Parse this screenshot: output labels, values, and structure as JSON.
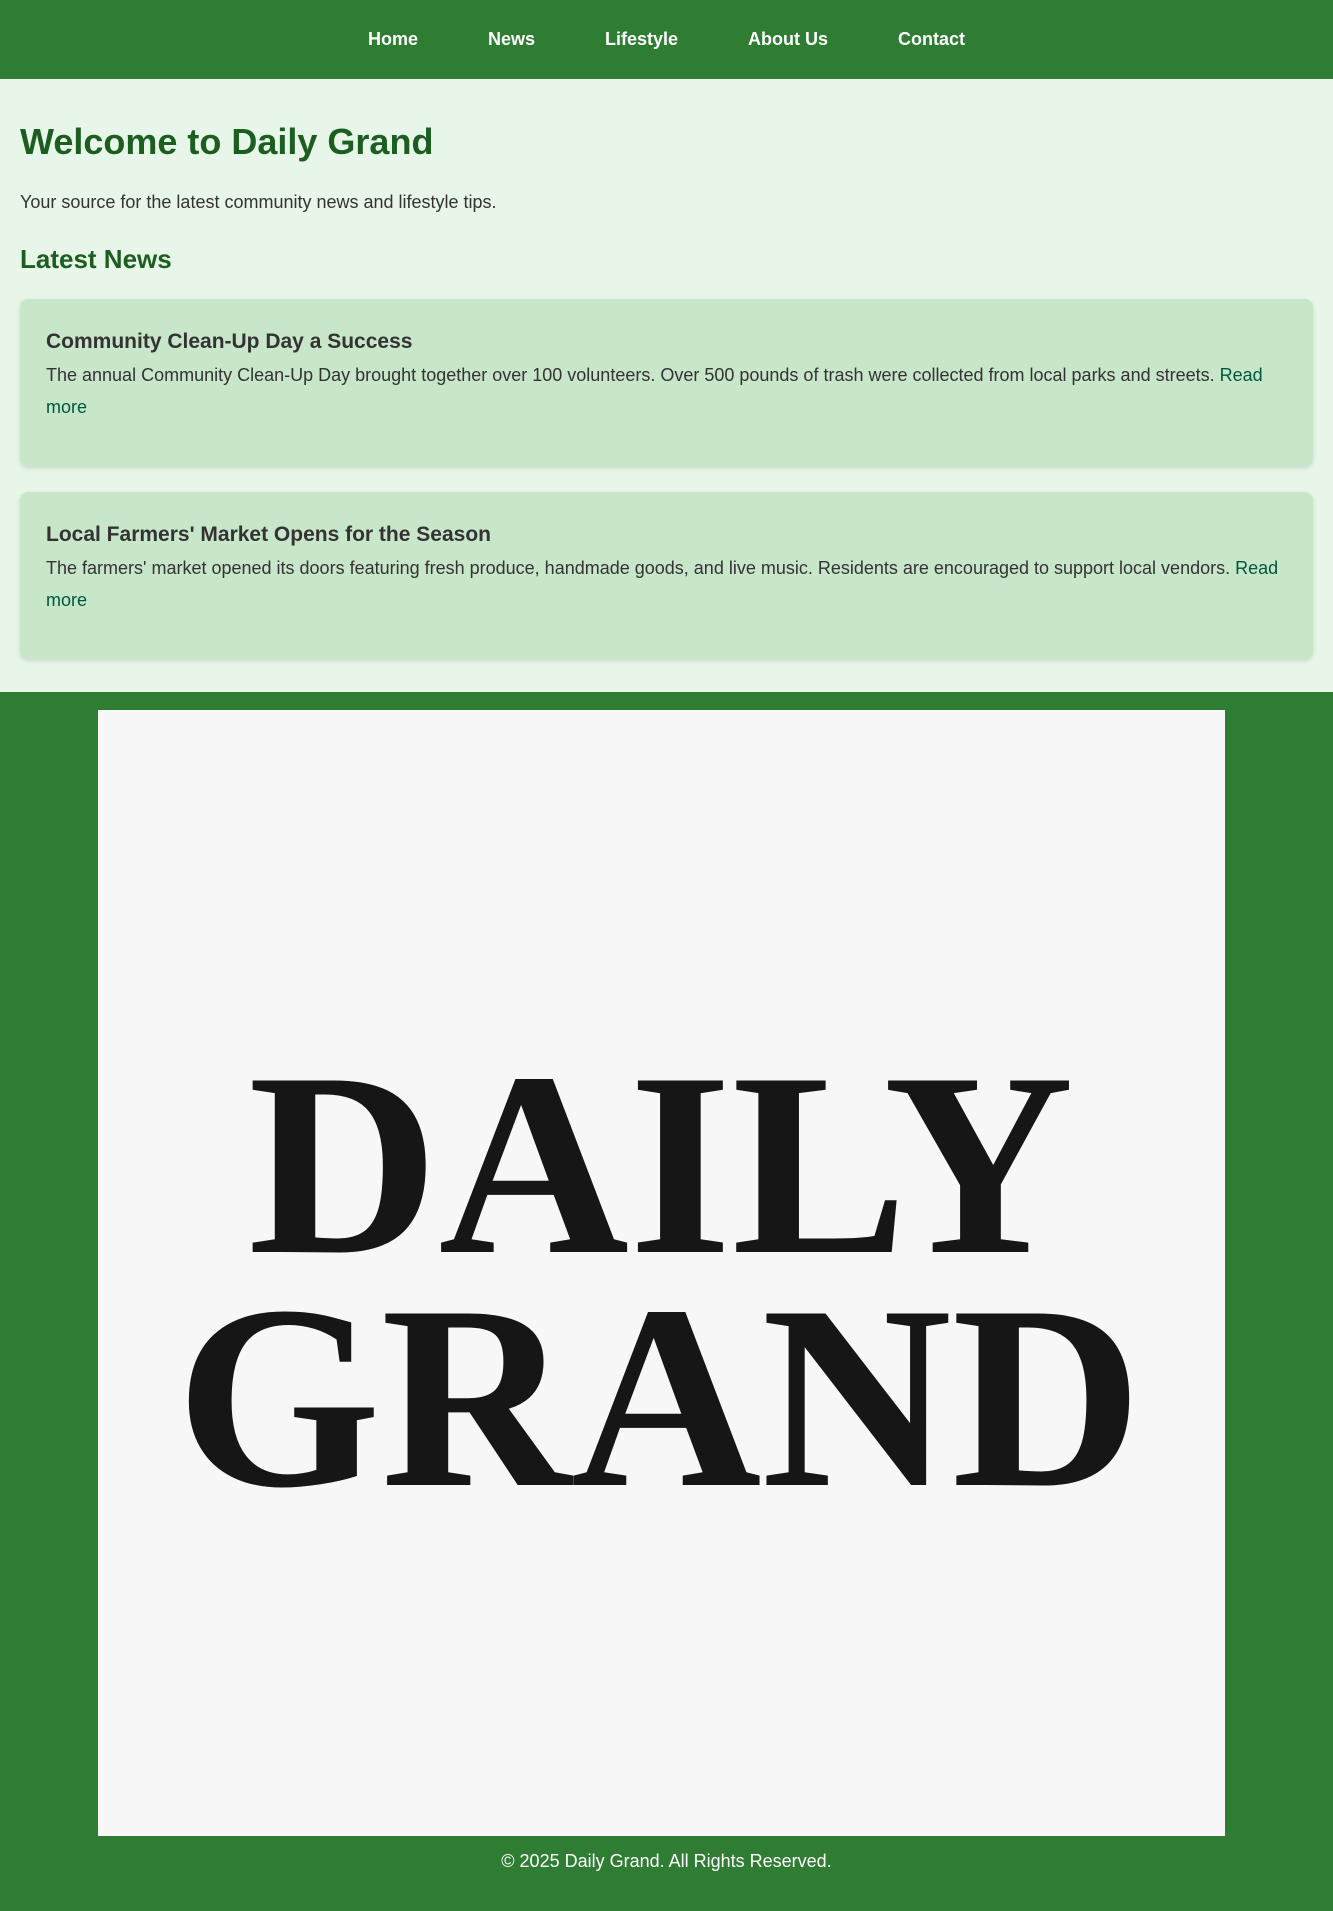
{
  "nav": {
    "items": [
      {
        "label": "Home"
      },
      {
        "label": "News"
      },
      {
        "label": "Lifestyle"
      },
      {
        "label": "About Us"
      },
      {
        "label": "Contact"
      }
    ]
  },
  "main": {
    "title": "Welcome to Daily Grand",
    "tagline": "Your source for the latest community news and lifestyle tips.",
    "section_heading": "Latest News",
    "articles": [
      {
        "title": "Community Clean-Up Day a Success",
        "body": "The annual Community Clean-Up Day brought together over 100 volunteers. Over 500 pounds of trash were collected from local parks and streets.",
        "link": "Read more"
      },
      {
        "title": "Local Farmers' Market Opens for the Season",
        "body": "The farmers' market opened its doors featuring fresh produce, handmade goods, and live music. Residents are encouraged to support local vendors.",
        "link": "Read more"
      }
    ]
  },
  "footer": {
    "logo_line1": "DAILY",
    "logo_line2": "GRAND",
    "copyright": "© 2025 Daily Grand. All Rights Reserved."
  },
  "colors": {
    "nav_bg": "#2e7d32",
    "page_bg": "#e8f5e9",
    "heading": "#1b5e20",
    "card_bg": "#c8e6c9",
    "link": "#00573f",
    "logo_bg": "#f7f7f7",
    "logo_text": "#161616"
  }
}
